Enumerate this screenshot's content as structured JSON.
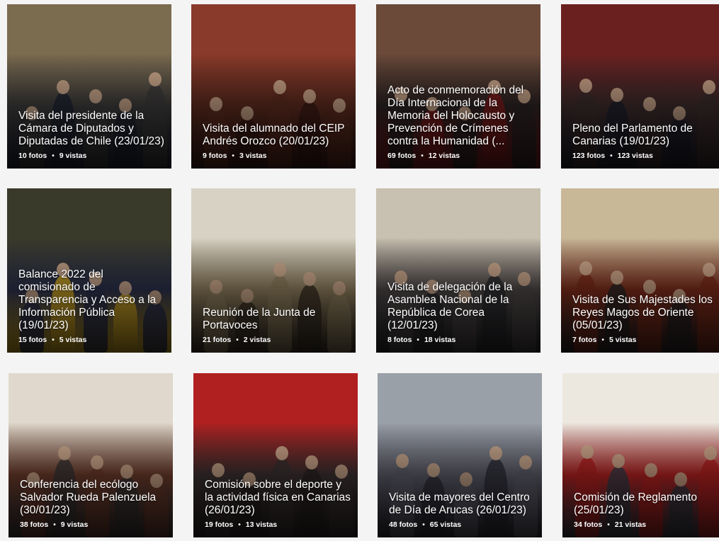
{
  "albums": [
    {
      "title": "Visita del presidente de la Cámara de Diputados y Diputadas de Chile (23/01/23)",
      "photos": "10 fotos",
      "views": "9 vistas",
      "palette": [
        "#7b6b4f",
        "#3b3a3a",
        "#1f2330"
      ]
    },
    {
      "title": "Visita del alumnado del CEIP Andrés Orozco (20/01/23)",
      "photos": "9 fotos",
      "views": "3 vistas",
      "palette": [
        "#8a3a2a",
        "#5a2a1e",
        "#3a1a14"
      ]
    },
    {
      "title": "Acto de conmemoración del Día Internacional de la Memoria del Holocausto y Prevención de Crímenes contra la Humanidad (...",
      "photos": "69 fotos",
      "views": "12 vistas",
      "palette": [
        "#6b4a3a",
        "#2a2222",
        "#7a1a1a"
      ]
    },
    {
      "title": "Pleno del Parlamento de Canarias (19/01/23)",
      "photos": "123 fotos",
      "views": "123 vistas",
      "palette": [
        "#6b2020",
        "#3a2a2a",
        "#1e1e2a"
      ]
    },
    {
      "title": "Balance 2022 del comisionado de Transparencia y Acceso a la Información Pública (19/01/23)",
      "photos": "15 fotos",
      "views": "5 vistas",
      "palette": [
        "#3a3a2a",
        "#2a2f4a",
        "#c9a020"
      ]
    },
    {
      "title": "Reunión de la Junta de Portavoces",
      "photos": "21 fotos",
      "views": "2 vistas",
      "palette": [
        "#d8d2c4",
        "#8a7a5a",
        "#3a3025"
      ]
    },
    {
      "title": "Visita de delegación de la Asamblea Nacional de la República de Corea (12/01/23)",
      "photos": "8 fotos",
      "views": "18 vistas",
      "palette": [
        "#c8c0b0",
        "#4a4444",
        "#2a2a2e"
      ]
    },
    {
      "title": "Visita de Sus Majestades los Reyes Magos de Oriente (05/01/23)",
      "photos": "7 fotos",
      "views": "5 vistas",
      "palette": [
        "#c8b898",
        "#7a2a1a",
        "#2a2424"
      ]
    },
    {
      "title": "Conferencia del ecólogo Salvador Rueda Palenzuela (30/01/23)",
      "photos": "38 fotos",
      "views": "9 vistas",
      "palette": [
        "#e0d8cc",
        "#6a3a2a",
        "#3a3434"
      ]
    },
    {
      "title": "Comisión sobre el deporte y la actividad física en Canarias (26/01/23)",
      "photos": "19 fotos",
      "views": "13 vistas",
      "palette": [
        "#b02020",
        "#3a3030",
        "#2a2222"
      ]
    },
    {
      "title": "Visita de mayores del Centro de Día de Arucas (26/01/23)",
      "photos": "48 fotos",
      "views": "65 vistas",
      "palette": [
        "#9aa0a8",
        "#5a5a66",
        "#2e2e38"
      ]
    },
    {
      "title": "Comisión de Reglamento (25/01/23)",
      "photos": "34 fotos",
      "views": "21 vistas",
      "palette": [
        "#ece8e0",
        "#b02020",
        "#3a3a44"
      ]
    }
  ]
}
